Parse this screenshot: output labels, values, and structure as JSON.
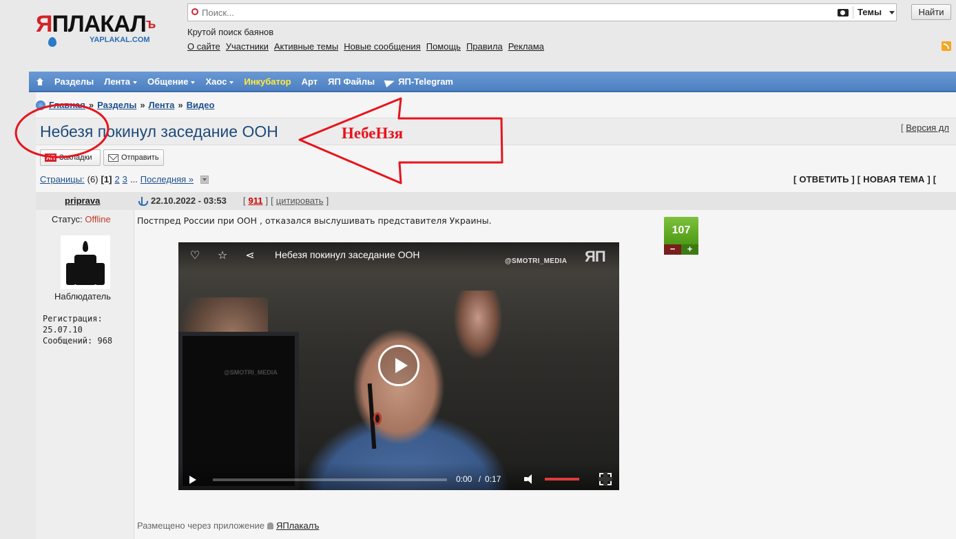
{
  "logo": {
    "wordmark_red": "Я",
    "wordmark_rest": "ПЛАКАЛ",
    "wordmark_suffix": "ъ",
    "sub": "YAPLAKAL.COM"
  },
  "search": {
    "placeholder": "Поиск...",
    "scope": "Темы",
    "button": "Найти"
  },
  "tagline": "Крутой поиск баянов",
  "toplinks": [
    "О сайте",
    "Участники",
    "Активные темы",
    "Новые сообщения",
    "Помощь",
    "Правила",
    "Реклама"
  ],
  "nav": {
    "items": [
      {
        "label": "Разделы",
        "caret": false,
        "highlight": false
      },
      {
        "label": "Лента",
        "caret": true,
        "highlight": false
      },
      {
        "label": "Общение",
        "caret": true,
        "highlight": false
      },
      {
        "label": "Хаос",
        "caret": true,
        "highlight": false
      },
      {
        "label": "Инкубатор",
        "caret": false,
        "highlight": true
      },
      {
        "label": "Арт",
        "caret": false,
        "highlight": false
      },
      {
        "label": "ЯП Файлы",
        "caret": false,
        "highlight": false
      }
    ],
    "telegram": "ЯП-Telegram",
    "accent": "#5288c9",
    "highlight_color": "#ffec3d"
  },
  "breadcrumb": {
    "home": "Главная",
    "c1": "Разделы",
    "c2": "Лента",
    "c3": "Видео",
    "sep": "»"
  },
  "topic": {
    "title": "Небезя покинул заседание ООН",
    "print_link": "Версия дл",
    "print_prefix": "["
  },
  "toolbar": {
    "bookmarks_badge": "ЯП",
    "bookmarks": "Закладки",
    "send": "Отправить"
  },
  "pager": {
    "label": "Страницы:",
    "count": "(6)",
    "current": "[1]",
    "p2": "2",
    "p3": "3",
    "ellipsis": "...",
    "last": "Последняя »"
  },
  "actions": {
    "reply": "[ ОТВЕТИТЬ ]",
    "new_topic": "[ НОВАЯ ТЕМА ]",
    "more": "["
  },
  "post": {
    "author": "priprava",
    "date": "22.10.2022 - 03:53",
    "number": "911",
    "quote": "цитировать",
    "text": "Постпред России при ООН , отказался выслушивать представителя Украины.",
    "rating": "107",
    "minus": "−",
    "plus": "+"
  },
  "user": {
    "status_label": "Статус:",
    "status_value": "Offline",
    "rank": "Наблюдатель",
    "reg_label": "Регистрация:",
    "reg_date": "25.07.10",
    "msgs": "Сообщений: 968"
  },
  "video": {
    "title": "Небезя покинул заседание ООН",
    "watermark": "@SMOTRI_MEDIA",
    "watermark_faint": "@SMOTRI_MEDIA",
    "logo": "ЯП",
    "current_time": "0:00",
    "time_sep": "/",
    "duration": "0:17"
  },
  "posted_via": {
    "prefix": "Размещено через приложение",
    "app": "ЯПлакалъ"
  },
  "annotation": {
    "text": "НебеНзя",
    "color": "#e8131c"
  }
}
